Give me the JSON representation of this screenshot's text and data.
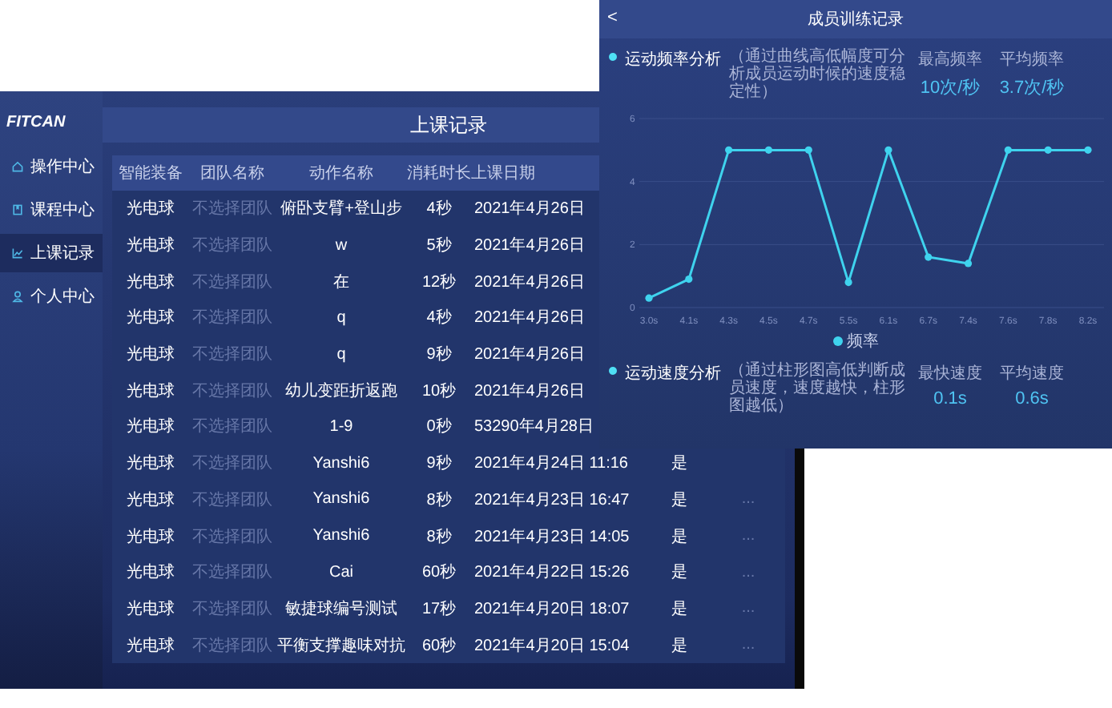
{
  "class_screen": {
    "logo": "FITCAN",
    "nav": [
      {
        "label": "操作中心",
        "selected": false
      },
      {
        "label": "课程中心",
        "selected": false
      },
      {
        "label": "上课记录",
        "selected": true
      },
      {
        "label": "个人中心",
        "selected": false
      }
    ],
    "title": "上课记录",
    "table": {
      "columns": [
        {
          "label": "智能装备",
          "dim": false
        },
        {
          "label": "团队名称",
          "dim": true
        },
        {
          "label": "动作名称",
          "dim": false
        },
        {
          "label": "消耗时长",
          "dim": false
        },
        {
          "label": "上课日期",
          "dim": false
        },
        {
          "dim": false
        },
        {
          "dim": true
        }
      ],
      "rows": [
        [
          "光电球",
          "不选择团队",
          "俯卧支臂+登山步",
          "4秒",
          "2021年4月26日"
        ],
        [
          "光电球",
          "不选择团队",
          "w",
          "5秒",
          "2021年4月26日"
        ],
        [
          "光电球",
          "不选择团队",
          "在",
          "12秒",
          "2021年4月26日"
        ],
        [
          "光电球",
          "不选择团队",
          "q",
          "4秒",
          "2021年4月26日"
        ],
        [
          "光电球",
          "不选择团队",
          "q",
          "9秒",
          "2021年4月26日"
        ],
        [
          "光电球",
          "不选择团队",
          "幼儿变距折返跑",
          "10秒",
          "2021年4月26日"
        ],
        [
          "光电球",
          "不选择团队",
          "1-9",
          "0秒",
          "53290年4月28日"
        ],
        [
          "光电球",
          "不选择团队",
          "Yanshi6",
          "9秒",
          "2021年4月24日 11:16",
          "是"
        ],
        [
          "光电球",
          "不选择团队",
          "Yanshi6",
          "8秒",
          "2021年4月23日 16:47",
          "是",
          "..."
        ],
        [
          "光电球",
          "不选择团队",
          "Yanshi6",
          "8秒",
          "2021年4月23日 14:05",
          "是",
          "..."
        ],
        [
          "光电球",
          "不选择团队",
          "Cai",
          "60秒",
          "2021年4月22日 15:26",
          "是",
          "..."
        ],
        [
          "光电球",
          "不选择团队",
          "敏捷球编号测试",
          "17秒",
          "2021年4月20日 18:07",
          "是",
          "..."
        ],
        [
          "光电球",
          "不选择团队",
          "平衡支撑趣味对抗",
          "60秒",
          "2021年4月20日 15:04",
          "是",
          "..."
        ]
      ]
    }
  },
  "member_screen": {
    "back": "<",
    "title": "成员训练记录",
    "sections": [
      {
        "label": "运动频率分析",
        "note": "（通过曲线高低幅度可分析成员运动时候的速度稳定性）",
        "stats": [
          {
            "label": "最高频率",
            "value": "10次/秒"
          },
          {
            "label": "平均频率",
            "value": "3.7次/秒"
          }
        ],
        "chart_data": {
          "type": "line",
          "categories": [
            "3.0s",
            "4.1s",
            "4.3s",
            "4.5s",
            "4.7s",
            "5.5s",
            "6.1s",
            "6.7s",
            "7.4s",
            "7.6s",
            "7.8s",
            "8.2s"
          ],
          "ylim": [
            0,
            6
          ],
          "yticks": [
            0,
            2,
            4,
            6
          ],
          "series": [
            {
              "name": "频率",
              "color": "#3fd3ee",
              "marker": true,
              "values": [
                0.3,
                0.9,
                5,
                5,
                5,
                0.8,
                5,
                1.6,
                1.4,
                5,
                5,
                5
              ]
            }
          ]
        }
      },
      {
        "label": "运动速度分析",
        "note": "（通过柱形图高低判断成员速度，速度越快，柱形图越低）",
        "stats": [
          {
            "label": "最快速度",
            "value": "0.1s"
          },
          {
            "label": "平均速度",
            "value": "0.6s"
          }
        ]
      }
    ]
  }
}
